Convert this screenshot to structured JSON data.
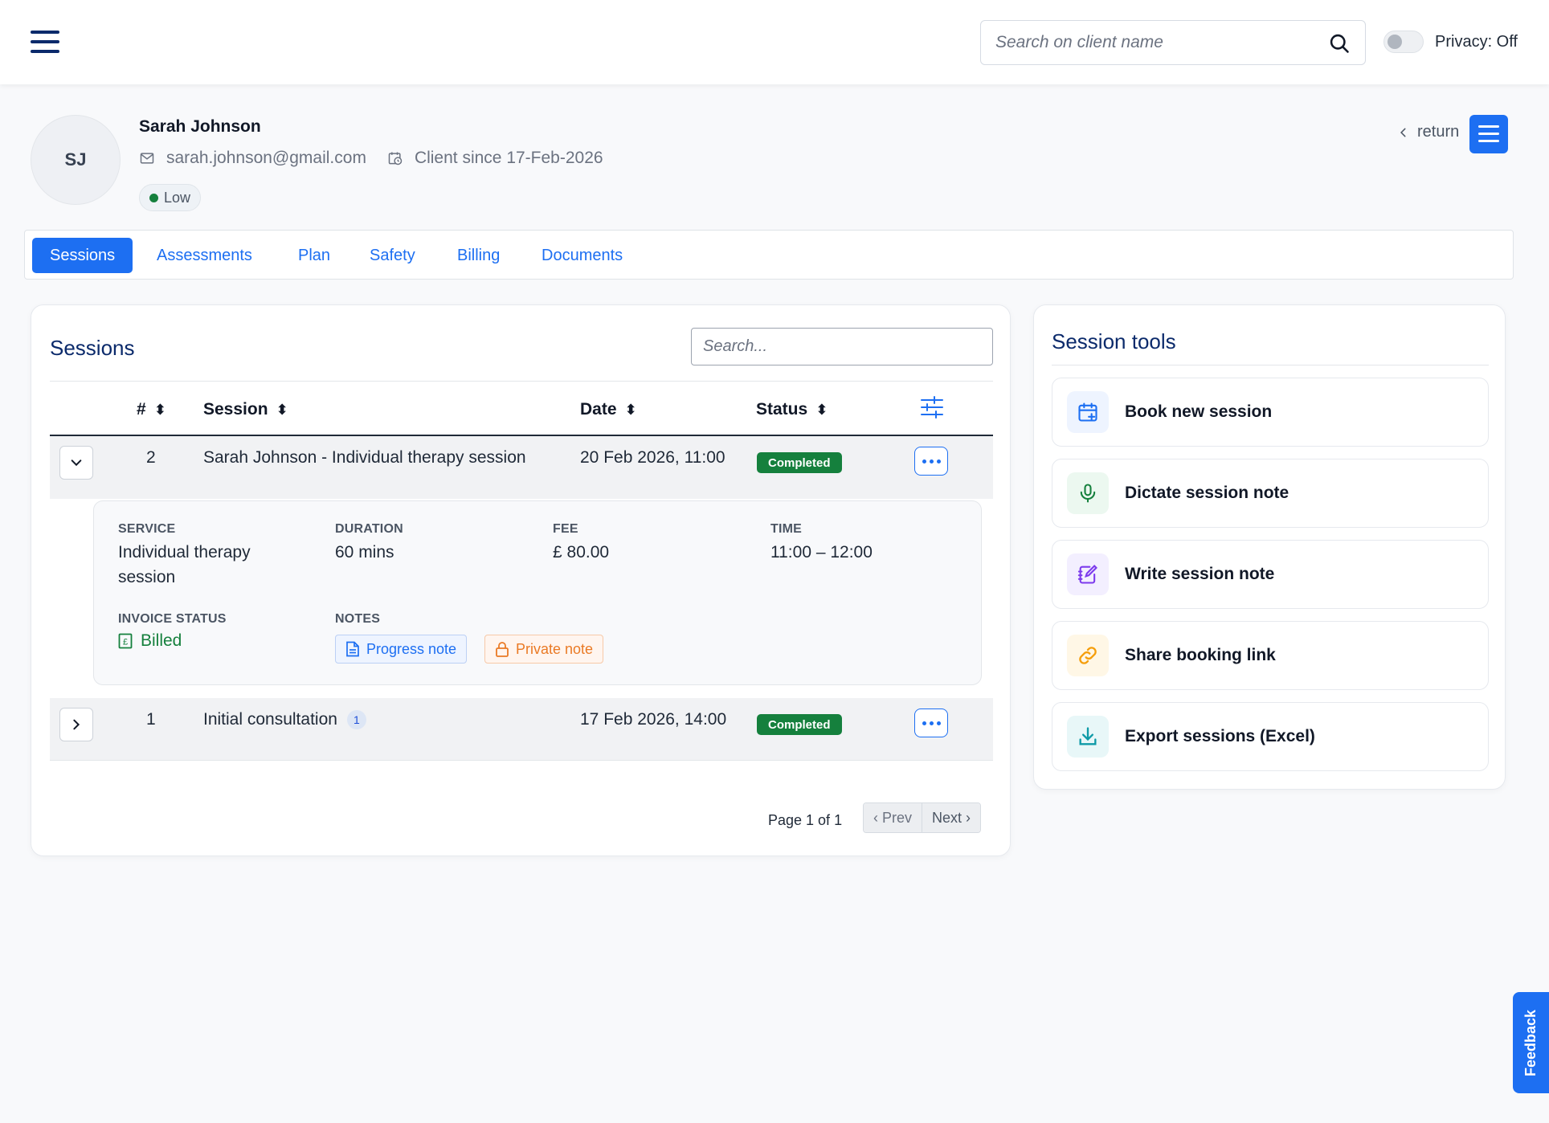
{
  "header": {
    "search_placeholder": "Search on client name",
    "privacy_label": "Privacy: Off",
    "privacy_on": false
  },
  "client": {
    "initials": "SJ",
    "name": "Sarah Johnson",
    "email": "sarah.johnson@gmail.com",
    "since": "Client since 17-Feb-2026",
    "risk_level": "Low",
    "return_label": "return"
  },
  "tabs": [
    {
      "label": "Sessions",
      "active": true
    },
    {
      "label": "Assessments",
      "active": false
    },
    {
      "label": "Plan",
      "active": false
    },
    {
      "label": "Safety",
      "active": false
    },
    {
      "label": "Billing",
      "active": false
    },
    {
      "label": "Documents",
      "active": false
    }
  ],
  "sessions": {
    "title": "Sessions",
    "search_placeholder": "Search...",
    "columns": {
      "num": "#",
      "session": "Session",
      "date": "Date",
      "status": "Status"
    },
    "rows": [
      {
        "num": "2",
        "session": "Sarah Johnson - Individual therapy session",
        "date": "20 Feb 2026, 11:00",
        "status": "Completed",
        "expanded": true,
        "details": {
          "service_label": "SERVICE",
          "service": "Individual therapy session",
          "duration_label": "DURATION",
          "duration": "60 mins",
          "fee_label": "FEE",
          "fee": "£ 80.00",
          "time_label": "TIME",
          "time": "11:00 – 12:00",
          "invoice_label": "INVOICE STATUS",
          "invoice_status": "Billed",
          "notes_label": "NOTES",
          "notes": [
            "Progress note",
            "Private note"
          ]
        }
      },
      {
        "num": "1",
        "session": "Initial consultation",
        "count": "1",
        "date": "17 Feb 2026, 14:00",
        "status": "Completed",
        "expanded": false
      }
    ],
    "pager": {
      "text": "Page 1 of 1",
      "prev": "‹ Prev",
      "next": "Next ›"
    }
  },
  "tools": {
    "title": "Session tools",
    "items": [
      {
        "label": "Book new session",
        "icon": "calendar-plus-icon",
        "color": "#1d6ff2"
      },
      {
        "label": "Dictate session note",
        "icon": "microphone-icon",
        "color": "#15803d"
      },
      {
        "label": "Write session note",
        "icon": "edit-note-icon",
        "color": "#7c3aed"
      },
      {
        "label": "Share booking link",
        "icon": "link-icon",
        "color": "#f59e0b"
      },
      {
        "label": "Export sessions (Excel)",
        "icon": "download-icon",
        "color": "#0e9aa7"
      }
    ]
  },
  "feedback_label": "Feedback",
  "colors": {
    "primary": "#1d6ff2",
    "navy": "#0b2a6b",
    "success": "#15803d",
    "warning": "#ea7a25"
  }
}
